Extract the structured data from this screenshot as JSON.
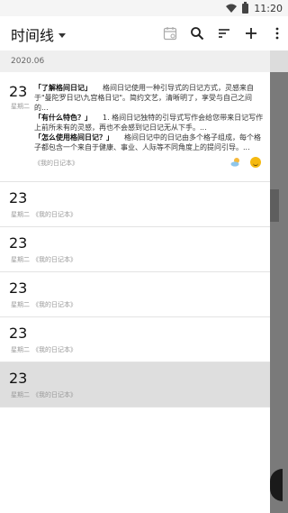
{
  "status": {
    "time": "11:20"
  },
  "appbar": {
    "title": "时间线"
  },
  "date_header": "2020.06",
  "first_entry": {
    "day": "23",
    "weekday": "星期二",
    "notebook": "《我的日记本》",
    "lines": [
      {
        "bold": "「了解格间日记」",
        "text": "　　格间日记使用一种引导式的日记方式，灵感来自于\"曼陀罗日记\\九宫格日记\"。简约文艺，清晰明了，享受与自己之间的..."
      },
      {
        "bold": "「有什么特色？」",
        "text": "　　1. 格间日记独特的引导式写作会给您带来日记写作上前所未有的灵感，再也不会感到记日记无从下手。..."
      },
      {
        "bold": "「怎么使用格间日记？」",
        "text": "　　格间日记中的日记由多个格子组成，每个格子都包含一个来自于健康、事业、人际等不同角度上的提问引导。..."
      }
    ]
  },
  "entries": [
    {
      "day": "23",
      "weekday": "星期二",
      "notebook": "《我的日记本》"
    },
    {
      "day": "23",
      "weekday": "星期二",
      "notebook": "《我的日记本》"
    },
    {
      "day": "23",
      "weekday": "星期二",
      "notebook": "《我的日记本》"
    },
    {
      "day": "23",
      "weekday": "星期二",
      "notebook": "《我的日记本》"
    },
    {
      "day": "23",
      "weekday": "星期二",
      "notebook": "《我的日记本》"
    }
  ]
}
